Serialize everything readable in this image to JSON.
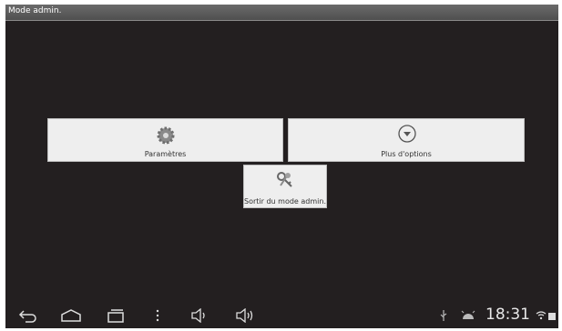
{
  "window": {
    "title": "Mode admin."
  },
  "buttons": {
    "settings": {
      "label": "Paramètres",
      "icon": "gear-icon"
    },
    "more_options": {
      "label": "Plus d'options",
      "icon": "chevron-down-circle-icon"
    },
    "exit_admin": {
      "label": "Sortir du mode admin.",
      "icon": "keys-icon"
    }
  },
  "navbar": {
    "icons": [
      "back-icon",
      "home-icon",
      "recent-apps-icon",
      "menu-icon",
      "volume-down-icon",
      "volume-up-icon"
    ]
  },
  "status": {
    "time": "18:31",
    "icons": [
      "usb-icon",
      "android-debug-icon",
      "wifi-icon",
      "battery-icon"
    ]
  },
  "colors": {
    "background": "#231f20",
    "button": "#eeeeee",
    "titlebar": "#5a5a5a"
  }
}
